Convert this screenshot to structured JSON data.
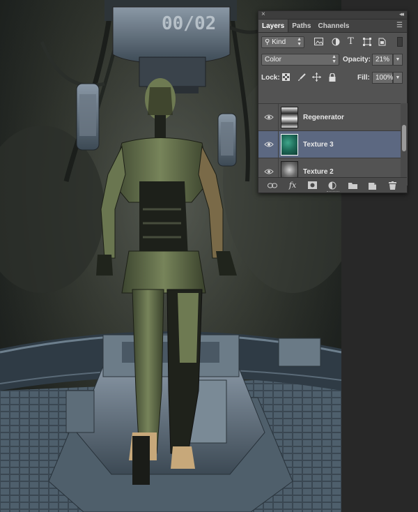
{
  "canvas": {
    "stencil_text": "00/02",
    "colors": {
      "backdrop_dark": "#1f2320",
      "robot_green": "#6e7a52",
      "metal_blue": "#5f7080",
      "skin": "#c7a87a"
    }
  },
  "panel": {
    "close_glyph": "×",
    "collapse_glyph": "◂◂",
    "tabs": [
      {
        "label": "Layers",
        "active": true
      },
      {
        "label": "Paths",
        "active": false
      },
      {
        "label": "Channels",
        "active": false
      }
    ],
    "menu_glyph": "☰",
    "filter": {
      "kind_label": "Kind",
      "icons": [
        "image-filter-icon",
        "adjustment-filter-icon",
        "type-filter-icon",
        "shape-filter-icon",
        "smart-object-filter-icon"
      ],
      "toggle": "filter-toggle"
    },
    "blend": {
      "mode": "Color",
      "opacity_label": "Opacity:",
      "opacity_value": "21%"
    },
    "lock": {
      "label": "Lock:",
      "icons": [
        "lock-transparent-icon",
        "lock-image-icon",
        "lock-position-icon",
        "lock-all-icon"
      ],
      "fill_label": "Fill:",
      "fill_value": "100%"
    },
    "layers": [
      {
        "name": "Regenerator",
        "visible": true,
        "selected": false,
        "thumb": "regenerator"
      },
      {
        "name": "Texture 3",
        "visible": true,
        "selected": true,
        "thumb": "teal"
      },
      {
        "name": "Texture 2",
        "visible": true,
        "selected": false,
        "thumb": "gray"
      }
    ],
    "bottom_icons": [
      "link-layers-icon",
      "fx-icon",
      "mask-icon",
      "adjustment-layer-icon",
      "new-group-icon",
      "new-layer-icon",
      "trash-icon"
    ],
    "fx_label": "fx",
    "colors": {
      "panel_bg": "#535353",
      "selected_row": "#5c6881",
      "field": "#6a6a6a"
    }
  }
}
